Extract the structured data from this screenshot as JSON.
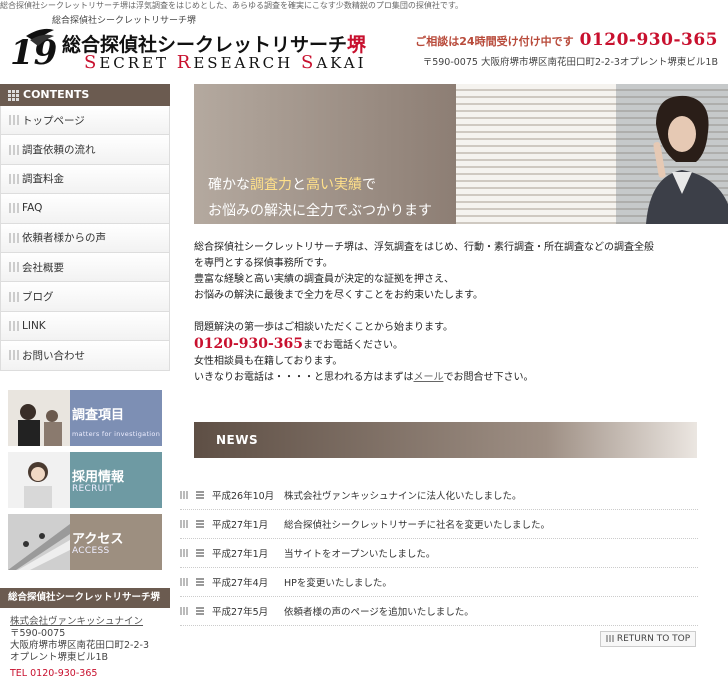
{
  "top_description": "総合探偵社シークレットリサーチ堺は浮気調査をはじめとした、あらゆる調査を確実にこなす少数精鋭のプロ集団の探偵社です。",
  "header": {
    "subtitle_small": "総合探偵社シークレットリサーチ堺",
    "title_main": "総合探偵社シークレットリサーチ",
    "title_accent": "堺",
    "title_english": "Secret Research Sakai",
    "contact_label": "ご相談は24時間受け付け中です",
    "phone": "0120-930-365",
    "address": "〒590-0075 大阪府堺市堺区南花田口町2-2-3オプレント堺東ビル1B"
  },
  "sidebar": {
    "contents_heading": "CONTENTS",
    "items": [
      {
        "label": "トップページ"
      },
      {
        "label": "調査依頼の流れ"
      },
      {
        "label": "調査料金"
      },
      {
        "label": "FAQ"
      },
      {
        "label": "依頼者様からの声"
      },
      {
        "label": "会社概要"
      },
      {
        "label": "ブログ"
      },
      {
        "label": "LINK"
      },
      {
        "label": "お問い合わせ"
      }
    ],
    "promos": [
      {
        "title": "調査項目",
        "subtitle": "matters for investigation"
      },
      {
        "title": "採用情報",
        "subtitle": "RECRUIT"
      },
      {
        "title": "アクセス",
        "subtitle": "ACCESS"
      }
    ],
    "company": {
      "heading": "総合探偵社シークレットリサーチ堺",
      "link": "株式会社ヴァンキッシュナイン",
      "zip": "〒590-0075",
      "address1": "大阪府堺市堺区南花田口町2-2-3",
      "address2": "オプレント堺東ビル1B",
      "tel": "TEL 0120-930-365"
    }
  },
  "hero": {
    "line1_pre": "確かな",
    "line1_hl1": "調査力",
    "line1_mid": "と",
    "line1_hl2": "高い実績",
    "line1_post": "で",
    "line2": "お悩みの解決に全力でぶつかります"
  },
  "intro": {
    "p1_line1": "総合探偵社シークレットリサーチ堺は、浮気調査をはじめ、行動・素行調査・所在調査などの調査全般",
    "p1_line2": "を専門とする探偵事務所です。",
    "p1_line3": "豊富な経験と高い実績の調査員が決定的な証拠を押さえ、",
    "p1_line4": "お悩みの解決に最後まで全力を尽くすことをお約束いたします。",
    "p2_line1": "問題解決の第一歩はご相談いただくことから始まります。",
    "phone": "0120-930-365",
    "phone_suffix": "までお電話ください。",
    "p2_line3": "女性相談員も在籍しております。",
    "p2_line4_pre": "いきなりお電話は・・・・と思われる方はまずは",
    "mail_link": "メール",
    "p2_line4_post": "でお問合せ下さい。"
  },
  "news": {
    "heading": "NEWS",
    "items": [
      {
        "date": "平成26年10月",
        "text": "株式会社ヴァンキッシュナインに法人化いたしました。"
      },
      {
        "date": "平成27年1月",
        "text": "総合探偵社シークレットリサーチに社名を変更いたしました。"
      },
      {
        "date": "平成27年1月",
        "text": "当サイトをオープンいたしました。"
      },
      {
        "date": "平成27年4月",
        "text": "HPを変更いたしました。"
      },
      {
        "date": "平成27年5月",
        "text": "依頼者様の声のページを追加いたしました。"
      }
    ],
    "return_label": "RETURN TO TOP"
  }
}
